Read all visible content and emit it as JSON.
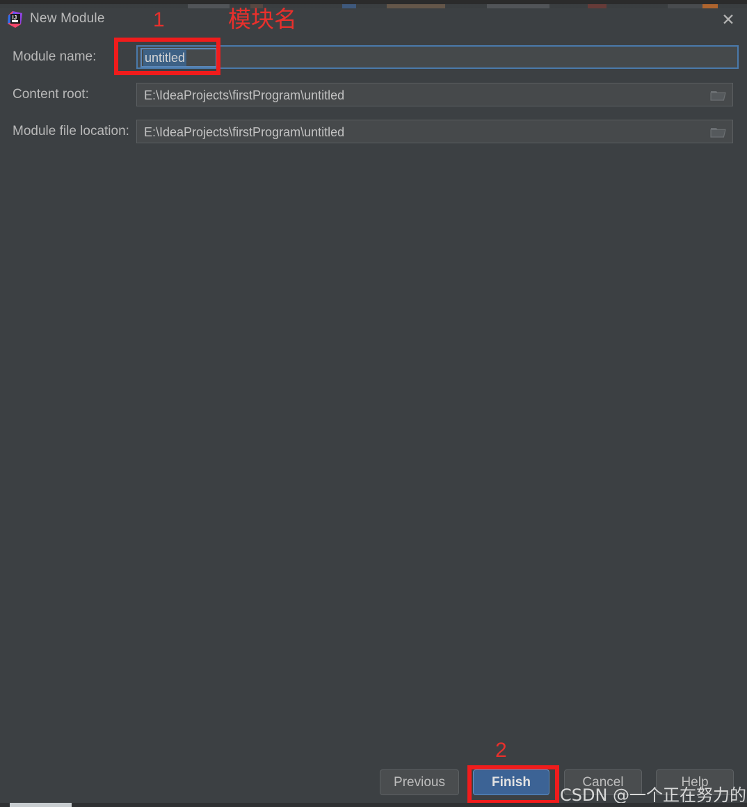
{
  "window": {
    "title": "New Module",
    "app_icon": "intellij-idea-icon",
    "close_icon": "close-icon"
  },
  "form": {
    "rows": [
      {
        "label": "Module name:",
        "value": "untitled",
        "selected": true,
        "focused": true,
        "has_browse": false
      },
      {
        "label": "Content root:",
        "value": "E:\\IdeaProjects\\firstProgram\\untitled",
        "selected": false,
        "focused": false,
        "has_browse": true,
        "browse_icon": "folder-icon"
      },
      {
        "label": "Module file location:",
        "value": "E:\\IdeaProjects\\firstProgram\\untitled",
        "selected": false,
        "focused": false,
        "has_browse": true,
        "browse_icon": "folder-icon"
      }
    ]
  },
  "annotations": {
    "step_one": "1",
    "step_two": "2",
    "chinese_note": "模块名",
    "color": "#e8302c"
  },
  "footer": {
    "buttons": [
      {
        "label": "Previous",
        "style": "normal"
      },
      {
        "label": "Finish",
        "style": "primary"
      },
      {
        "label": "Cancel",
        "style": "normal"
      },
      {
        "label": "Help",
        "style": "normal"
      }
    ]
  },
  "watermark": {
    "text": "CSDN @一个正在努力的菜鸡"
  },
  "colors": {
    "dialog_background": "#3c4043",
    "field_background": "#46494b",
    "focus_border": "#4a7aab",
    "selection_background": "#3d6185",
    "primary_button": "#3c6395",
    "annotation_red": "#f01c1c",
    "label_text": "#b8b8b8"
  }
}
